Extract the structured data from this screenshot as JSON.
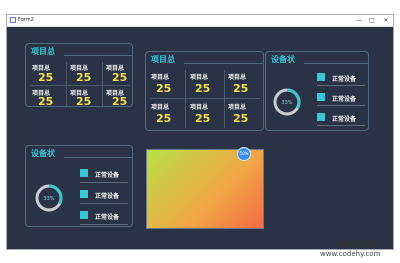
{
  "window": {
    "title": "Form2",
    "min": "—",
    "max": "□",
    "close": "✕"
  },
  "panel_a": {
    "title": "项目总",
    "cells": [
      {
        "label": "项目总",
        "value": "25"
      },
      {
        "label": "项目总",
        "value": "25"
      },
      {
        "label": "项目总",
        "value": "25"
      },
      {
        "label": "项目总",
        "value": "25"
      },
      {
        "label": "项目总",
        "value": "25"
      },
      {
        "label": "项目总",
        "value": "25"
      }
    ]
  },
  "panel_b": {
    "title": "项目总",
    "cells": [
      {
        "label": "项目总",
        "value": "25"
      },
      {
        "label": "项目总",
        "value": "25"
      },
      {
        "label": "项目总",
        "value": "25"
      },
      {
        "label": "项目总",
        "value": "25"
      },
      {
        "label": "项目总",
        "value": "25"
      },
      {
        "label": "项目总",
        "value": "25"
      }
    ]
  },
  "panel_c": {
    "title": "设备状",
    "ring_text": "33%",
    "ring_fraction": 0.33,
    "devices": [
      "正常设备",
      "正常设备",
      "正常设备"
    ]
  },
  "panel_d": {
    "title": "设备状",
    "ring_text": "33%",
    "ring_fraction": 0.33,
    "devices": [
      "正常设备",
      "正常设备",
      "正常设备"
    ]
  },
  "gradient": {
    "bubble_text": "50%",
    "colors": [
      "#b8e046",
      "#f2a646",
      "#f36b45"
    ]
  },
  "watermark": {
    "line1": "源码海洋网",
    "line2": "www.codehy.com"
  }
}
